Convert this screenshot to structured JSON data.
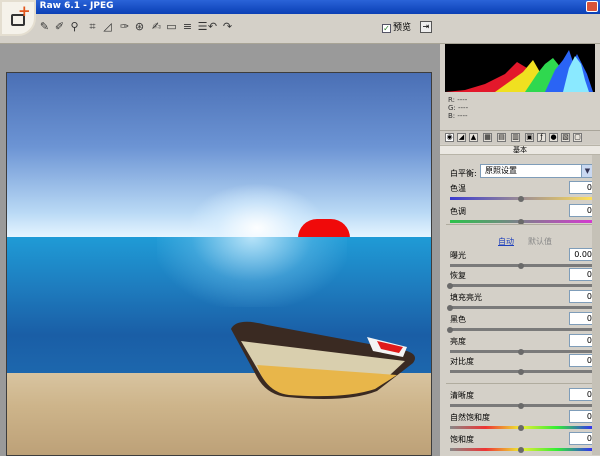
{
  "window": {
    "title": "ra  Raw 6.1 -  JPEG"
  },
  "toolbar": {
    "tools": [
      "zoom-tool",
      "white-balance-tool",
      "color-sampler-tool",
      "crop-tool",
      "straighten-tool",
      "retouch-tool",
      "red-eye-tool",
      "adjustment-brush-tool",
      "graduated-filter-tool",
      "hand-tool",
      "preferences-tool",
      "rotate-left-tool",
      "rotate-right-tool"
    ],
    "preview_label": "预览",
    "preview_checked": true
  },
  "histogram": {
    "r": "R:  ----",
    "g": "G:  ----",
    "b": "B:  ----"
  },
  "panel": {
    "section_title": "基本",
    "white_balance_label": "白平衡:",
    "white_balance_value": "原照设置",
    "auto_label": "自动",
    "default_label": "默认值",
    "sliders": [
      {
        "key": "temp",
        "label": "色温",
        "value": "0",
        "level": 0.5
      },
      {
        "key": "tint",
        "label": "色调",
        "value": "0",
        "level": 0.5
      },
      {
        "key": "exposure",
        "label": "曝光",
        "value": "0.00",
        "level": 0.5
      },
      {
        "key": "recovery",
        "label": "恢复",
        "value": "0",
        "level": 0.0
      },
      {
        "key": "fill",
        "label": "填充亮光",
        "value": "0",
        "level": 0.0
      },
      {
        "key": "blacks",
        "label": "黑色",
        "value": "0",
        "level": 0.0
      },
      {
        "key": "brightness",
        "label": "亮度",
        "value": "0",
        "level": 0.5
      },
      {
        "key": "contrast",
        "label": "对比度",
        "value": "0",
        "level": 0.5
      },
      {
        "key": "clarity",
        "label": "清晰度",
        "value": "0",
        "level": 0.5
      },
      {
        "key": "vibrance",
        "label": "自然饱和度",
        "value": "0",
        "level": 0.5
      },
      {
        "key": "saturation",
        "label": "饱和度",
        "value": "0",
        "level": 0.5
      }
    ]
  },
  "colors": {
    "accent": "#1d3fbb",
    "clip_warning": "#f00a0a",
    "panel_bg": "#d4d0c8"
  }
}
